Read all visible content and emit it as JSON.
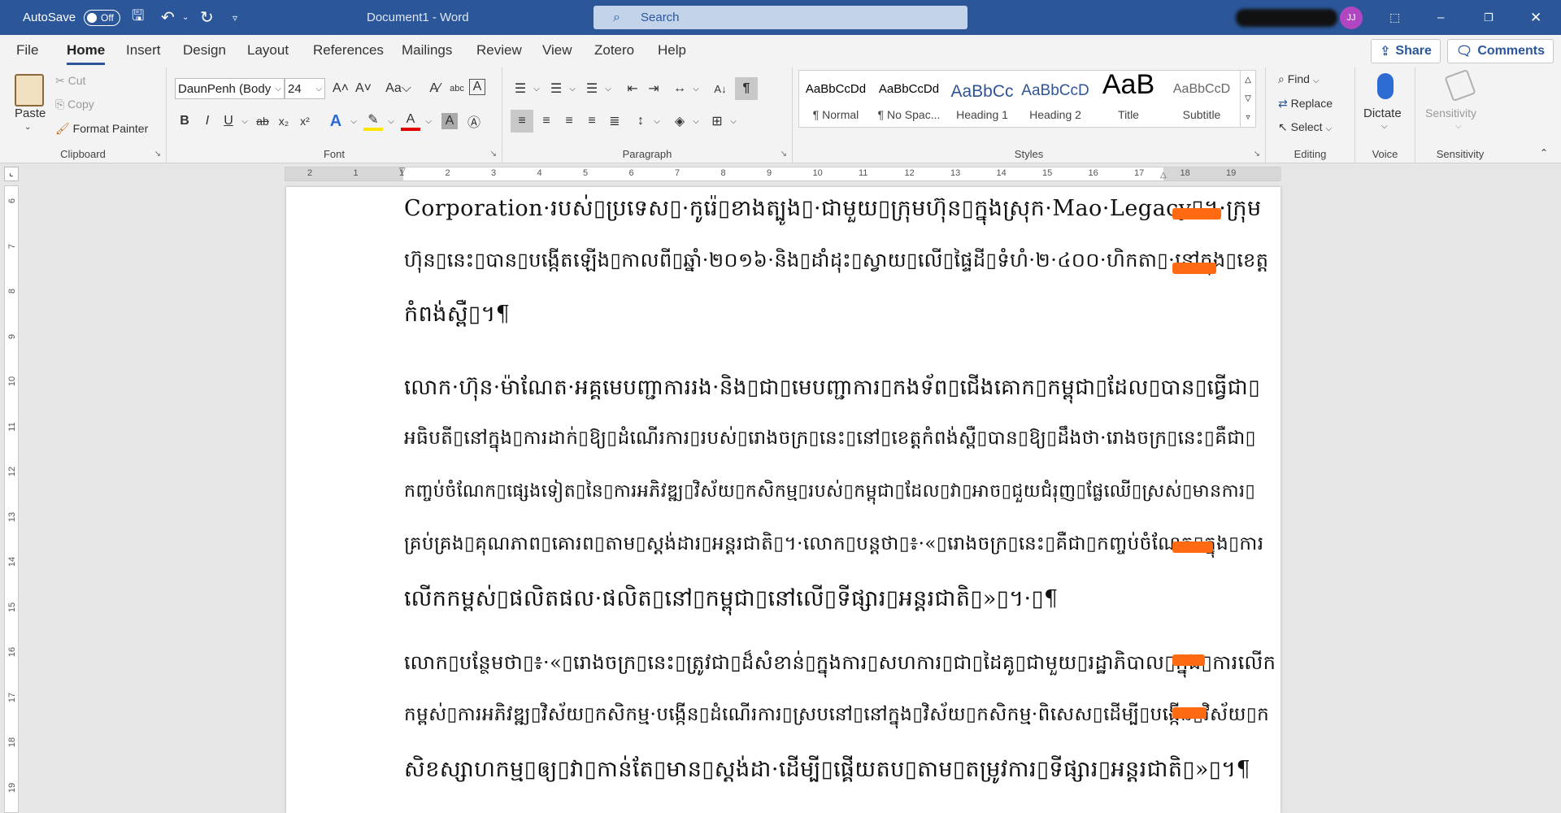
{
  "titlebar": {
    "autosave_label": "AutoSave",
    "autosave_state": "Off",
    "doc_title": "Document1 - Word",
    "search_placeholder": "Search",
    "avatar_initials": "JJ",
    "bg_color": "#2b579a"
  },
  "menu": {
    "tabs": [
      "File",
      "Home",
      "Insert",
      "Design",
      "Layout",
      "References",
      "Mailings",
      "Review",
      "View",
      "Zotero",
      "Help"
    ],
    "active_tab": "Home",
    "share_label": "Share",
    "comments_label": "Comments"
  },
  "clipboard": {
    "paste_label": "Paste",
    "cut_label": "Cut",
    "copy_label": "Copy",
    "format_painter_label": "Format Painter",
    "group_label": "Clipboard"
  },
  "font": {
    "name": "DaunPenh (Body",
    "size": "24",
    "group_label": "Font"
  },
  "paragraph": {
    "group_label": "Paragraph"
  },
  "styles": {
    "items": [
      {
        "preview": "AaBbCcDd",
        "name": "¶ Normal"
      },
      {
        "preview": "AaBbCcDd",
        "name": "¶ No Spac..."
      },
      {
        "preview": "AaBbCc",
        "name": "Heading 1"
      },
      {
        "preview": "AaBbCcD",
        "name": "Heading 2"
      },
      {
        "preview": "AaB",
        "name": "Title"
      },
      {
        "preview": "AaBbCcD",
        "name": "Subtitle"
      }
    ],
    "group_label": "Styles",
    "heading_color": "#2f5496"
  },
  "editing": {
    "find_label": "Find",
    "replace_label": "Replace",
    "select_label": "Select",
    "group_label": "Editing"
  },
  "voice": {
    "dictate_label": "Dictate",
    "group_label": "Voice"
  },
  "sensitivity": {
    "button_label": "Sensitivity",
    "group_label": "Sensitivity"
  },
  "ruler": {
    "h_labels": [
      "2",
      "1",
      "1",
      "2",
      "3",
      "4",
      "5",
      "6",
      "7",
      "8",
      "9",
      "10",
      "11",
      "12",
      "13",
      "14",
      "15",
      "16",
      "17",
      "18",
      "19"
    ],
    "v_labels": [
      "6",
      "7",
      "8",
      "9",
      "10",
      "11",
      "12",
      "13",
      "14",
      "15",
      "16",
      "17",
      "18",
      "19"
    ]
  },
  "document": {
    "lines": [
      "Corporation·របស់▯ប្រទេស▯·កូរ៉េ▯ខាងត្បូង▯·ជាមួយ▯ក្រុមហ៊ុន▯ក្នុងស្រុក·Mao·Legacy▯។·ក្រុម",
      "ហ៊ុន▯នេះ▯បាន▯បង្កើតឡើង▯កាលពី▯ឆ្នាំ·២០១៦·និង▯ដាំដុះ▯ស្វាយ▯លើ▯ផ្ទៃដី▯ទំហំ·២·៤០០·ហិកតា▯·នៅក្នុង▯ខេត្ត",
      "កំពង់ស្ពឺ▯។¶",
      "លោក·ហ៊ុន·ម៉ាណែត·អគ្គមេបញ្ជាការរង·និង▯ជា▯មេបញ្ជាការ▯កងទ័ព▯ជើងគោក▯កម្ពុជា▯ដែល▯បាន▯ធ្វើជា▯",
      "អធិបតី▯នៅក្នុង▯ការដាក់▯ឱ្យ▯ដំណើរការ▯របស់▯រោងចក្រ▯នេះ▯នៅ▯ខេត្តកំពង់ស្ពឺ▯បាន▯ឱ្យ▯ដឹងថា·រោងចក្រ▯នេះ▯គឺជា▯",
      "កញ្ចប់ចំណែក▯ផ្សេងទៀត▯នៃ▯ការអភិវឌ្ឍ▯វិស័យ▯កសិកម្ម▯របស់▯កម្ពុជា▯ដែល▯វា▯អាច▯ជួយជំរុញ▯ផ្លែឈើ▯ស្រស់▯មានការ▯",
      "គ្រប់គ្រង▯គុណភាព▯គោរព▯តាម▯ស្តង់ដារ▯អន្តរជាតិ▯។·លោក▯បន្តថា▯៖·«▯រោងចក្រ▯នេះ▯គឺជា▯កញ្ចប់ចំណែក▯ក្នុង▯ការ",
      "លើកកម្ពស់▯ផលិតផល·ផលិត▯នៅ▯កម្ពុជា▯នៅលើ▯ទីផ្សារ▯អន្តរជាតិ▯»▯។·▯¶",
      "លោក▯បន្ថែមថា▯៖·«▯រោងចក្រ▯នេះ▯ត្រូវជា▯ដ៏សំខាន់▯ក្នុងការ▯សហការ▯ជា▯ដៃគូ▯ជាមួយ▯រដ្ឋាភិបាល▯ក្នុង▯ការលើក",
      "កម្ពស់▯ការអភិវឌ្ឍ▯វិស័យ▯កសិកម្ម·បង្កើន▯ដំណើរការ▯ស្របនៅ▯នៅក្នុង▯វិស័យ▯កសិកម្ម·ពិសេស▯ដើម្បី▯បង្កើន▯វិស័យ▯ក",
      "សិខស្សាហកម្ម▯ឲ្យ▯វា▯កាន់តែ▯មាន▯ស្តង់ដា·ដើម្បី▯ផ្គើយតប▯តាម▯តម្រូវការ▯ទីផ្សារ▯អន្តរជាតិ▯»▯។¶"
    ]
  }
}
